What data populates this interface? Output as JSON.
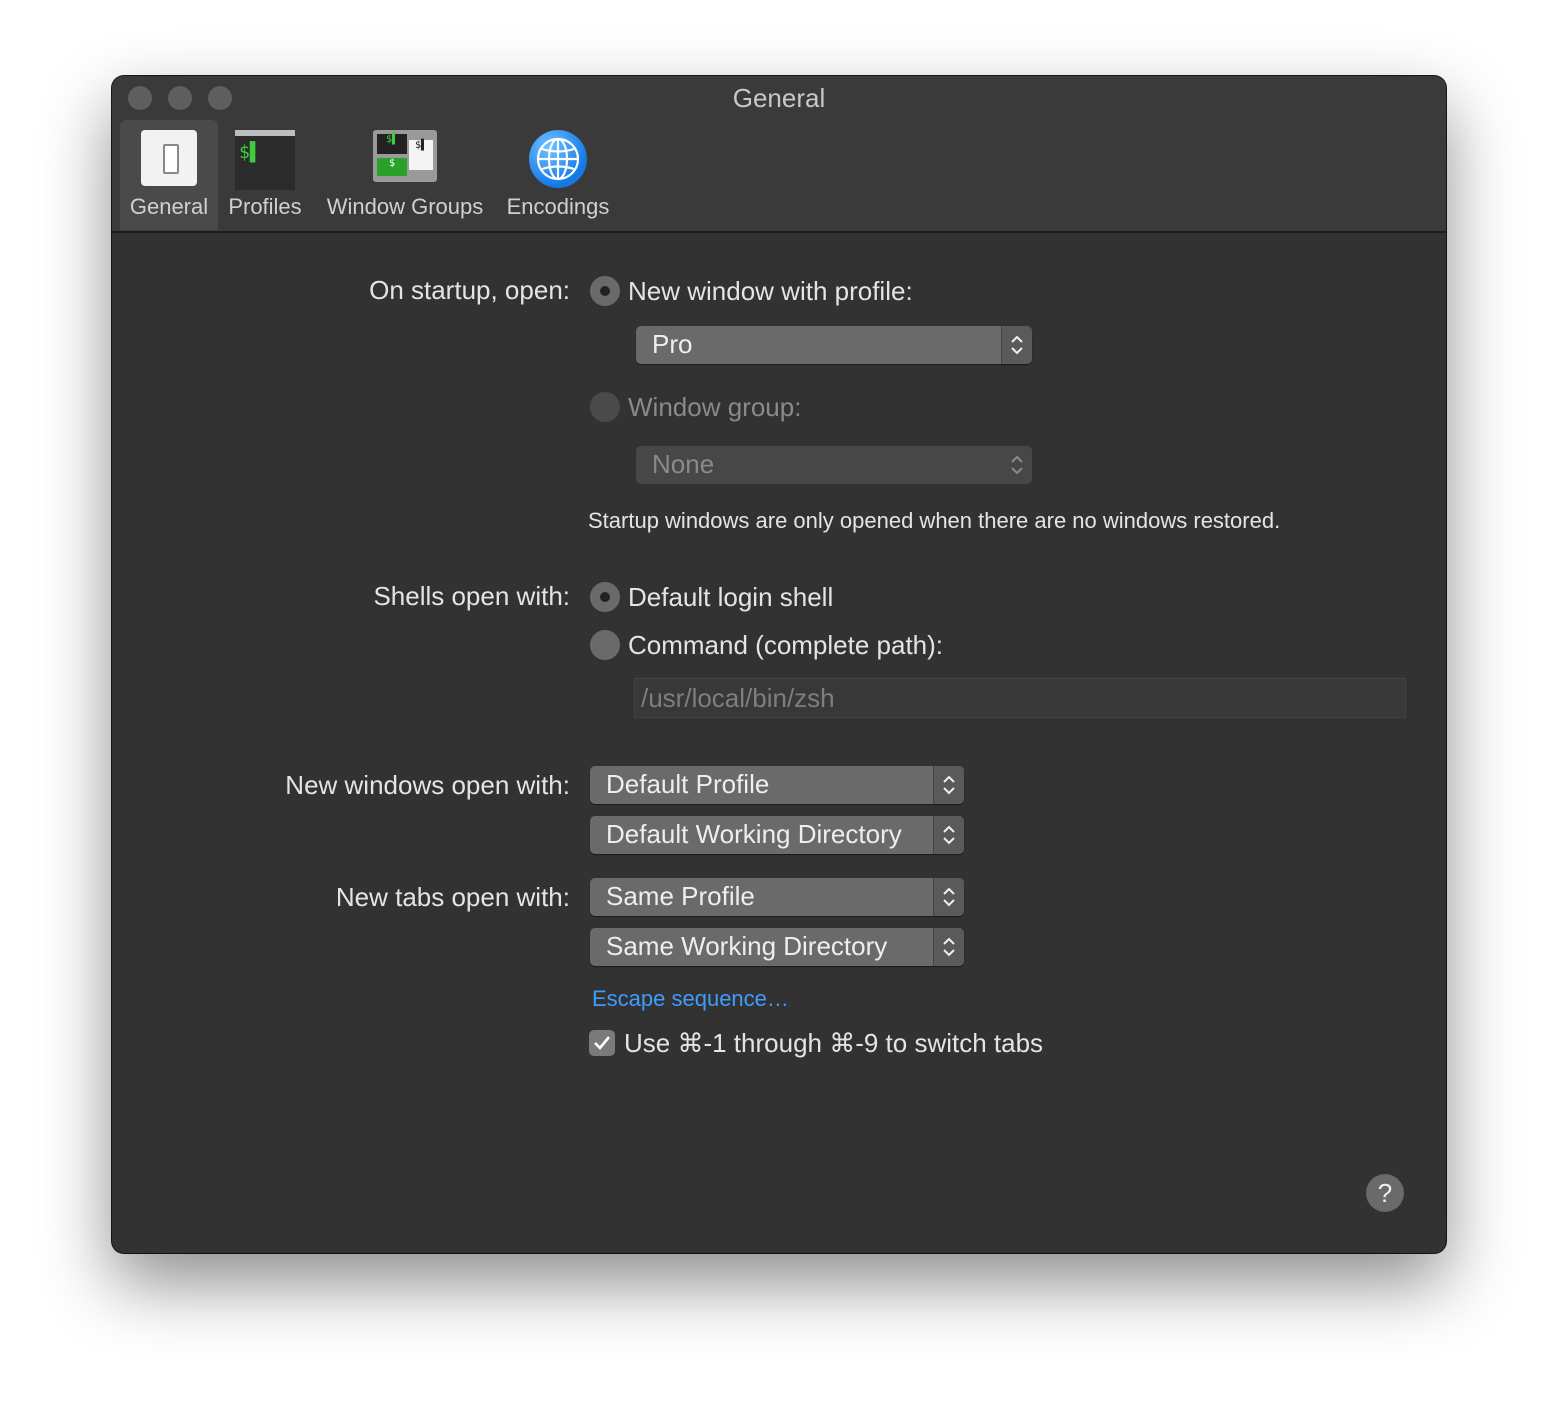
{
  "window": {
    "title": "General"
  },
  "toolbar": {
    "tabs": [
      {
        "label": "General",
        "icon": "general-switch-icon",
        "selected": true
      },
      {
        "label": "Profiles",
        "icon": "terminal-icon"
      },
      {
        "label": "Window Groups",
        "icon": "window-groups-icon"
      },
      {
        "label": "Encodings",
        "icon": "globe-icon"
      }
    ]
  },
  "startup": {
    "label": "On startup, open:",
    "option_profile": "New window with profile:",
    "profile_value": "Pro",
    "option_group": "Window group:",
    "group_value": "None",
    "note": "Startup windows are only opened when there are no windows restored."
  },
  "shells": {
    "label": "Shells open with:",
    "option_default": "Default login shell",
    "option_command": "Command (complete path):",
    "command_placeholder": "/usr/local/bin/zsh"
  },
  "new_windows": {
    "label": "New windows open with:",
    "profile": "Default Profile",
    "directory": "Default Working Directory"
  },
  "new_tabs": {
    "label": "New tabs open with:",
    "profile": "Same Profile",
    "directory": "Same Working Directory"
  },
  "escape_link": "Escape sequence…",
  "switch_tabs": {
    "label": "Use ⌘-1 through ⌘-9 to switch tabs",
    "checked": true
  },
  "help": "?"
}
